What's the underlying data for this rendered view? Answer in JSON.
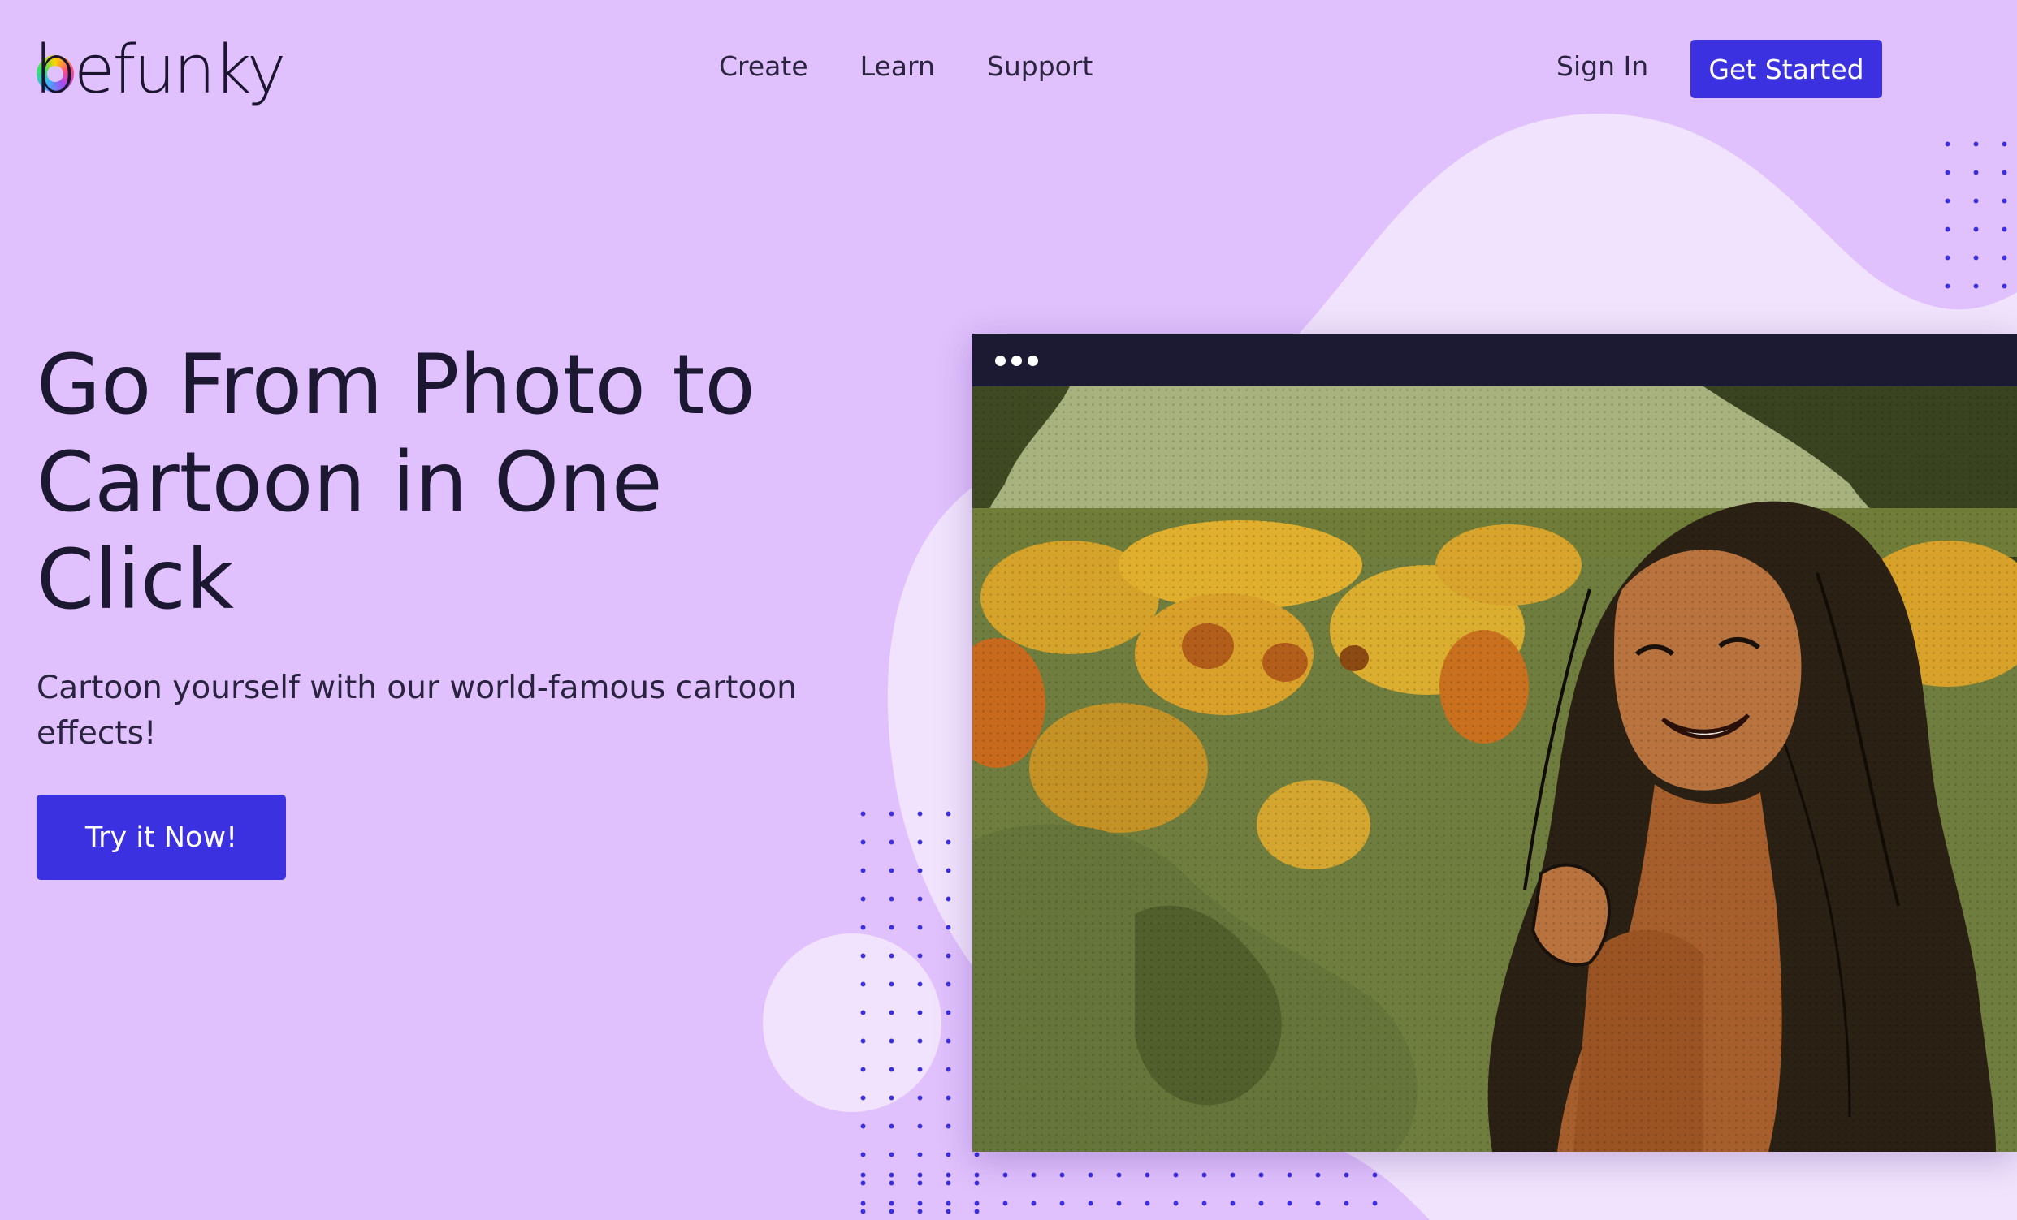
{
  "header": {
    "logo_text": "befunky",
    "nav": [
      "Create",
      "Learn",
      "Support"
    ],
    "sign_in": "Sign In",
    "get_started": "Get Started"
  },
  "hero": {
    "title": "Go From Photo to Cartoon in One Click",
    "subtitle": "Cartoon yourself with our world-famous cartoon effects!",
    "cta": "Try it Now!"
  },
  "preview": {
    "image": "cartoon-effect-photo-woman-in-sunflower-field"
  },
  "colors": {
    "background": "#e0c1fd",
    "accent": "#3b31e0",
    "text": "#1d1832",
    "window_bar": "#1c1a33",
    "blob": "#f1e3fd"
  }
}
